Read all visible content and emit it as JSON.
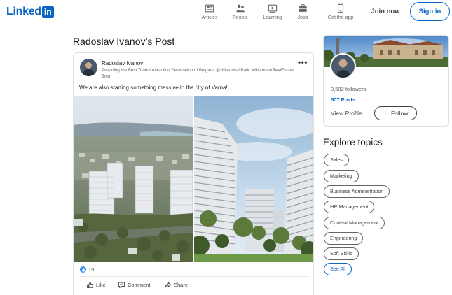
{
  "header": {
    "logo_text": "Linked",
    "logo_in": "in",
    "nav": [
      {
        "label": "Articles",
        "icon": "articles-icon"
      },
      {
        "label": "People",
        "icon": "people-icon"
      },
      {
        "label": "Learning",
        "icon": "learning-icon"
      },
      {
        "label": "Jobs",
        "icon": "jobs-icon"
      },
      {
        "label": "Get the app",
        "icon": "get-app-icon"
      }
    ],
    "join_label": "Join now",
    "signin_label": "Sign in"
  },
  "page_title": "Radoslav Ivanov’s Post",
  "post": {
    "author": "Radoslav Ivanov",
    "headline": "Providing the Best Tourist Attraction Destination of Bulgaria @ Historical Park. #HistoricalRealEstate...",
    "time": "5mo",
    "more_label": "•••",
    "text": "We are also starting something massive in the city of Varna!",
    "reaction_count": "19",
    "actions": {
      "like": "Like",
      "comment": "Comment",
      "share": "Share"
    }
  },
  "profile": {
    "followers": "3,582 followers",
    "posts": "507 Posts",
    "view_profile": "View Profile",
    "follow": "Follow"
  },
  "explore": {
    "title": "Explore topics",
    "topics": [
      "Sales",
      "Marketing",
      "Business Administration",
      "HR Management",
      "Content Management",
      "Engineering",
      "Soft Skills"
    ],
    "see_all": "See All"
  },
  "colors": {
    "brand": "#0a66c2",
    "reaction": "#378fe9"
  }
}
